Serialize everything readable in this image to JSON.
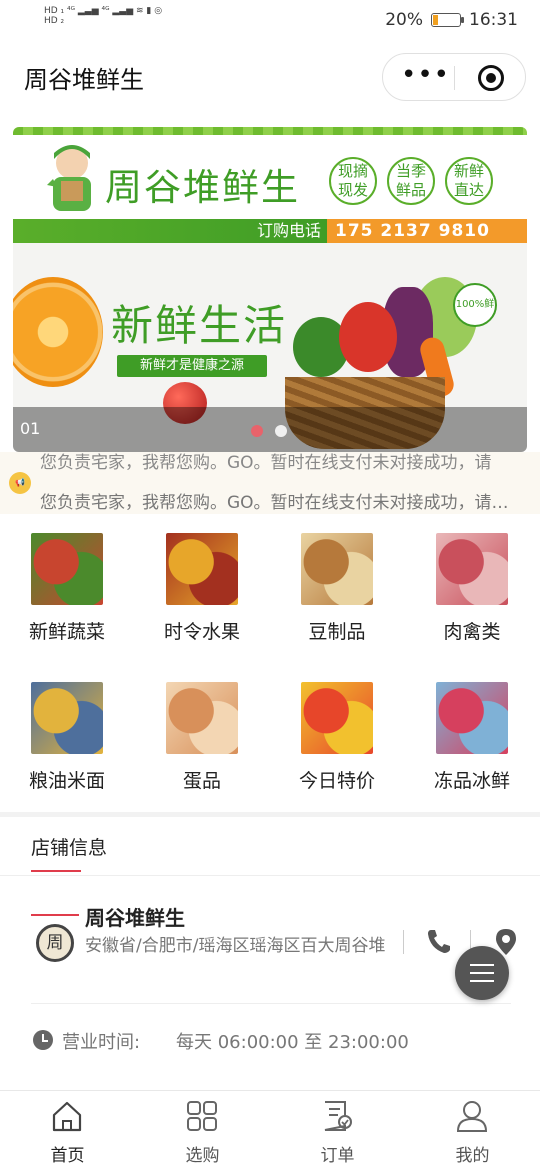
{
  "status_bar": {
    "network_left": "HD 4G 4G",
    "battery": "20%",
    "time": "16:31",
    "battery_level": 0.2
  },
  "nav": {
    "title": "周谷堆鲜生",
    "more_icon": "more-dots-icon",
    "close_icon": "target-circle-icon"
  },
  "banner": {
    "brand": "周谷堆鲜生",
    "badges": [
      "现摘\n现发",
      "当季\n鲜品",
      "新鲜\n直达"
    ],
    "order_label": "订购电话",
    "order_phone": "175 2137 9810",
    "slogan": "新鲜生活",
    "subslogan": "新鲜才是健康之源",
    "stamp": "100%鲜",
    "slide_index": "01",
    "dots": 2,
    "active_dot": 0
  },
  "notice": {
    "icon": "notice-icon",
    "line1": "您负责宅家，我帮您购。GO。暂时在线支付未对接成功，请",
    "line2": "您负责宅家，我帮您购。GO。暂时在线支付未对接成功，请…"
  },
  "categories": [
    {
      "label": "新鲜蔬菜",
      "color1": "#c8452f",
      "color2": "#4b8a2c"
    },
    {
      "label": "时令水果",
      "color1": "#e7a62a",
      "color2": "#a3301f"
    },
    {
      "label": "豆制品",
      "color1": "#b6793b",
      "color2": "#e9d3a1"
    },
    {
      "label": "肉禽类",
      "color1": "#c9505c",
      "color2": "#e9b7b8"
    },
    {
      "label": "粮油米面",
      "color1": "#e2b33d",
      "color2": "#4e6f9c"
    },
    {
      "label": "蛋品",
      "color1": "#d8905a",
      "color2": "#f3d6b3"
    },
    {
      "label": "今日特价",
      "color1": "#e7462a",
      "color2": "#f2c12e"
    },
    {
      "label": "冻品冰鲜",
      "color1": "#d6405e",
      "color2": "#7fb1d6"
    }
  ],
  "shop": {
    "section_title": "店铺信息",
    "name": "周谷堆鲜生",
    "address": "安徽省/合肥市/瑶海区瑶海区百大周谷堆",
    "logo_char": "周",
    "hours_label": "营业时间:",
    "hours_value": "每天 06:00:00 至 23:00:00"
  },
  "tabs": [
    {
      "label": "首页",
      "icon": "home-icon"
    },
    {
      "label": "选购",
      "icon": "grid-icon"
    },
    {
      "label": "订单",
      "icon": "order-icon"
    },
    {
      "label": "我的",
      "icon": "user-icon"
    }
  ],
  "colors": {
    "accent": "#e03c4b",
    "brand_green": "#3f9d26",
    "orange": "#f39a2a"
  }
}
